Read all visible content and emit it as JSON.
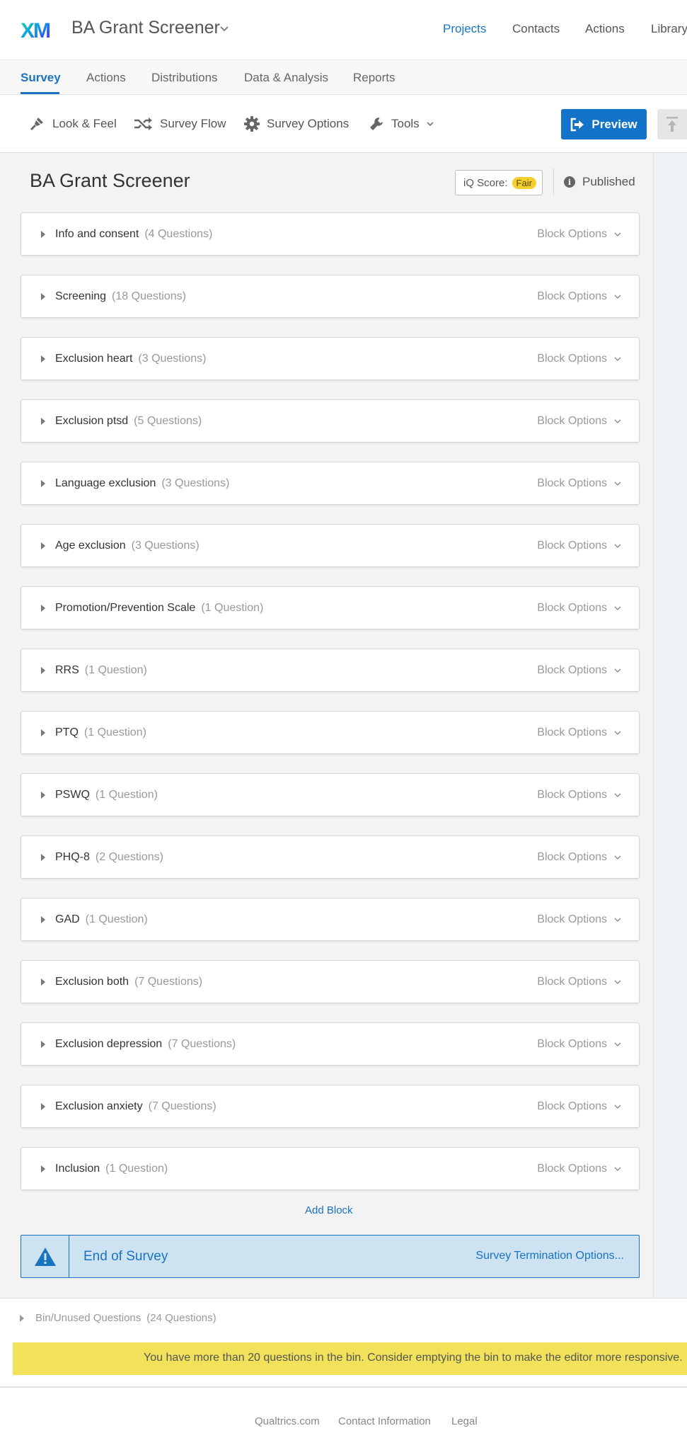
{
  "header": {
    "logo_text": "XM",
    "project_title": "BA Grant Screener",
    "nav": [
      "Projects",
      "Contacts",
      "Actions",
      "Library"
    ]
  },
  "tabs": [
    "Survey",
    "Actions",
    "Distributions",
    "Data & Analysis",
    "Reports"
  ],
  "toolbar": {
    "look_feel": "Look & Feel",
    "survey_flow": "Survey Flow",
    "survey_options": "Survey Options",
    "tools": "Tools",
    "preview": "Preview"
  },
  "survey": {
    "title": "BA Grant Screener",
    "iq_label": "iQ Score:",
    "iq_value": "Fair",
    "status": "Published",
    "block_options_label": "Block Options",
    "blocks": [
      {
        "name": "Info and consent",
        "count": "(4 Questions)"
      },
      {
        "name": "Screening",
        "count": "(18 Questions)"
      },
      {
        "name": "Exclusion heart",
        "count": "(3 Questions)"
      },
      {
        "name": "Exclusion ptsd",
        "count": "(5 Questions)"
      },
      {
        "name": "Language exclusion",
        "count": "(3 Questions)"
      },
      {
        "name": "Age exclusion",
        "count": "(3 Questions)"
      },
      {
        "name": "Promotion/Prevention Scale",
        "count": "(1 Question)"
      },
      {
        "name": "RRS",
        "count": "(1 Question)"
      },
      {
        "name": "PTQ",
        "count": "(1 Question)"
      },
      {
        "name": "PSWQ",
        "count": "(1 Question)"
      },
      {
        "name": "PHQ-8",
        "count": "(2 Questions)"
      },
      {
        "name": "GAD",
        "count": "(1 Question)"
      },
      {
        "name": "Exclusion both",
        "count": "(7 Questions)"
      },
      {
        "name": "Exclusion depression",
        "count": "(7 Questions)"
      },
      {
        "name": "Exclusion anxiety",
        "count": "(7 Questions)"
      },
      {
        "name": "Inclusion",
        "count": "(1 Question)"
      }
    ],
    "add_block": "Add Block",
    "end_of_survey": "End of Survey",
    "termination_options": "Survey Termination Options..."
  },
  "bin": {
    "label": "Bin/Unused Questions",
    "count": "(24 Questions)",
    "warning": "You have more than 20 questions in the bin. Consider emptying the bin to make the editor more responsive."
  },
  "footer": {
    "links": [
      "Qualtrics.com",
      "Contact Information",
      "Legal"
    ]
  },
  "colors": {
    "accent": "#1a73c0",
    "preview_button": "#1273c8",
    "iq_badge": "#f5cf2c",
    "warning_bg": "#f2e15a",
    "end_of_survey_bg": "#cde3f2"
  },
  "icons": {
    "look_feel": "paintbrush-icon",
    "survey_flow": "shuffle-icon",
    "survey_options": "gear-icon",
    "tools": "wrench-icon",
    "preview": "preview-arrow-icon",
    "status": "info-icon",
    "end_of_survey": "warning-triangle-icon",
    "block_expand": "caret-right-icon",
    "dropdown": "chevron-down-icon"
  }
}
